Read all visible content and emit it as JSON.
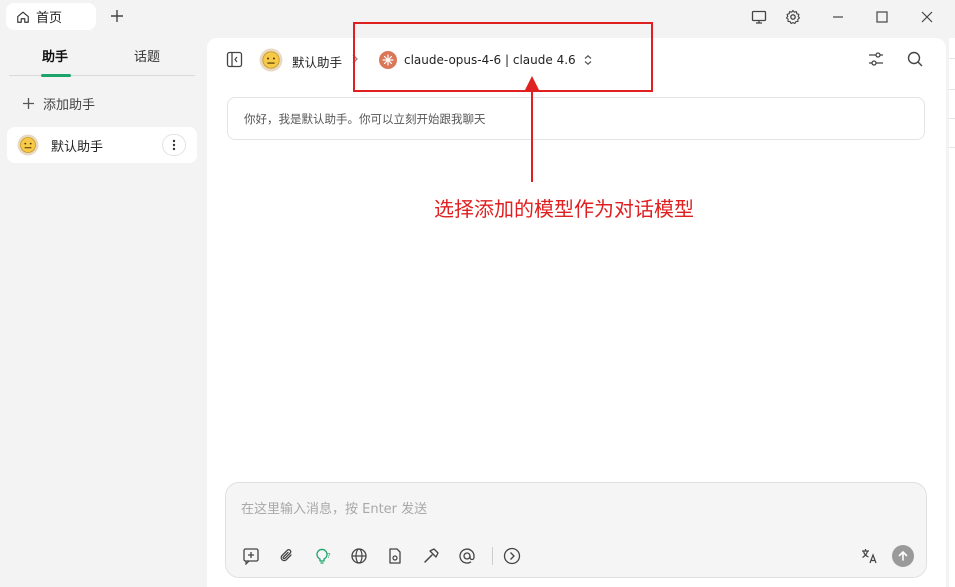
{
  "tabs": {
    "home_label": "首页"
  },
  "sidebar": {
    "tab_assistants": "助手",
    "tab_topics": "话题",
    "add_assistant_label": "添加助手",
    "items": [
      {
        "name": "默认助手",
        "avatar": "😐"
      }
    ]
  },
  "header": {
    "assistant_name": "默认助手",
    "assistant_avatar": "😐",
    "model_label": "claude-opus-4-6 | claude 4.6"
  },
  "chat": {
    "welcome_message": "你好，我是默认助手。你可以立刻开始跟我聊天"
  },
  "annotation": {
    "text": "选择添加的模型作为对话模型",
    "color": "#e02020"
  },
  "composer": {
    "placeholder": "在这里输入消息，按 Enter 发送"
  },
  "colors": {
    "accent": "#1aa36a",
    "model_logo": "#d97757"
  }
}
